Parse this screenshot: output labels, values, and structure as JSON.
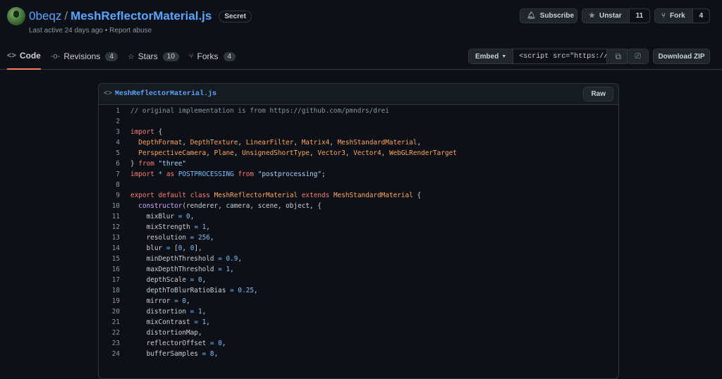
{
  "gist": {
    "owner": "0beqz",
    "filename": "MeshReflectorMaterial.js",
    "visibility": "Secret",
    "last_active": "Last active 24 days ago",
    "separator": "•",
    "report": "Report abuse"
  },
  "actions": {
    "subscribe_label": "Subscribe",
    "unstar_label": "Unstar",
    "star_count": "11",
    "fork_label": "Fork",
    "fork_count": "4"
  },
  "tabs": [
    {
      "label": "Code",
      "icon": "code-icon",
      "count": ""
    },
    {
      "label": "Revisions",
      "icon": "commit-icon",
      "count": "4"
    },
    {
      "label": "Stars",
      "icon": "star-icon",
      "count": "10"
    },
    {
      "label": "Forks",
      "icon": "fork-icon",
      "count": "4"
    }
  ],
  "embed": {
    "label": "Embed",
    "value": "<script src=\"https://"
  },
  "download_label": "Download ZIP",
  "file": {
    "name": "MeshReflectorMaterial.js",
    "raw_label": "Raw"
  },
  "code_lines": [
    {
      "num": "1",
      "text": "// original implementation is from https://github.com/pmndrs/drei"
    },
    {
      "num": "2",
      "text": ""
    },
    {
      "num": "3",
      "text": "import {"
    },
    {
      "num": "4",
      "text": "  DepthFormat, DepthTexture, LinearFilter, Matrix4, MeshStandardMaterial,"
    },
    {
      "num": "5",
      "text": "  PerspectiveCamera, Plane, UnsignedShortType, Vector3, Vector4, WebGLRenderTarget"
    },
    {
      "num": "6",
      "text": "} from \"three\""
    },
    {
      "num": "7",
      "text": "import * as POSTPROCESSING from \"postprocessing\";"
    },
    {
      "num": "8",
      "text": ""
    },
    {
      "num": "9",
      "text": "export default class MeshReflectorMaterial extends MeshStandardMaterial {"
    },
    {
      "num": "10",
      "text": "  constructor(renderer, camera, scene, object, {"
    },
    {
      "num": "11",
      "text": "    mixBlur = 0,"
    },
    {
      "num": "12",
      "text": "    mixStrength = 1,"
    },
    {
      "num": "13",
      "text": "    resolution = 256,"
    },
    {
      "num": "14",
      "text": "    blur = [0, 0],"
    },
    {
      "num": "15",
      "text": "    minDepthThreshold = 0.9,"
    },
    {
      "num": "16",
      "text": "    maxDepthThreshold = 1,"
    },
    {
      "num": "17",
      "text": "    depthScale = 0,"
    },
    {
      "num": "18",
      "text": "    depthToBlurRatioBias = 0.25,"
    },
    {
      "num": "19",
      "text": "    mirror = 0,"
    },
    {
      "num": "20",
      "text": "    distortion = 1,"
    },
    {
      "num": "21",
      "text": "    mixContrast = 1,"
    },
    {
      "num": "22",
      "text": "    distortionMap,"
    },
    {
      "num": "23",
      "text": "    reflectorOffset = 0,"
    },
    {
      "num": "24",
      "text": "    bufferSamples = 8,"
    }
  ]
}
